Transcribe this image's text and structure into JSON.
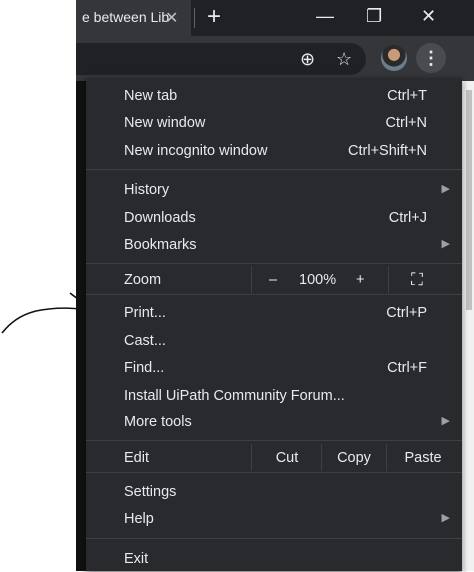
{
  "tab": {
    "title": "e between Lib",
    "close": "✕"
  },
  "new_tab_glyph": "+",
  "window_controls": {
    "minimize": "—",
    "restore": "❐",
    "close": "✕"
  },
  "toolbar": {
    "add_icon": "⊕",
    "star_icon": "☆",
    "menu_icon": "⋮"
  },
  "menu": {
    "group1": [
      {
        "label": "New tab",
        "shortcut": "Ctrl+T"
      },
      {
        "label": "New window",
        "shortcut": "Ctrl+N"
      },
      {
        "label": "New incognito window",
        "shortcut": "Ctrl+Shift+N"
      }
    ],
    "group2": [
      {
        "label": "History",
        "shortcut": ""
      },
      {
        "label": "Downloads",
        "shortcut": "Ctrl+J"
      },
      {
        "label": "Bookmarks",
        "shortcut": ""
      }
    ],
    "zoom": {
      "label": "Zoom",
      "minus": "–",
      "value": "100%",
      "plus": "+",
      "fullscreen_icon": "⛶"
    },
    "group3": [
      {
        "label": "Print...",
        "shortcut": "Ctrl+P"
      },
      {
        "label": "Cast...",
        "shortcut": ""
      },
      {
        "label": "Find...",
        "shortcut": "Ctrl+F"
      },
      {
        "label": "Install UiPath Community Forum...",
        "shortcut": ""
      },
      {
        "label": "More tools",
        "shortcut": ""
      }
    ],
    "edit": {
      "label": "Edit",
      "cut": "Cut",
      "copy": "Copy",
      "paste": "Paste"
    },
    "group4": [
      {
        "label": "Settings",
        "shortcut": ""
      },
      {
        "label": "Help",
        "shortcut": ""
      }
    ],
    "exit": {
      "label": "Exit"
    },
    "submenu_arrow": "▶"
  }
}
